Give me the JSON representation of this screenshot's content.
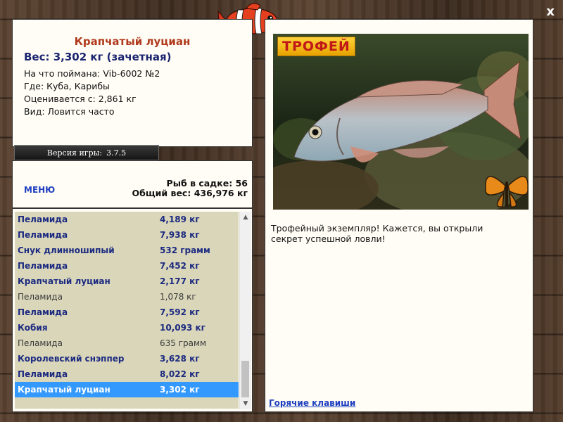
{
  "window": {
    "close_label": "x"
  },
  "info": {
    "title": "Крапчатый луциан",
    "weight_line": "Вес: 3,302 кг (зачетная)",
    "lines": [
      "На что поймана: Vib-6002 №2",
      "Где: Куба, Карибы",
      "Оценивается с: 2,861 кг",
      "Вид: Ловится часто"
    ]
  },
  "version": {
    "label": "Версия игры:",
    "value": "3.7.5"
  },
  "menu": {
    "label": "МЕНЮ"
  },
  "stats": {
    "fish_in_keepnet": "Рыб в садке: 56",
    "total_weight": "Общий вес: 436,976 кг"
  },
  "catch_list": [
    {
      "name": "Пеламида",
      "weight": "4,189 кг",
      "trophy": true,
      "selected": false
    },
    {
      "name": "Пеламида",
      "weight": "7,938 кг",
      "trophy": true,
      "selected": false
    },
    {
      "name": "Снук длинношипый",
      "weight": "532 грамм",
      "trophy": true,
      "selected": false
    },
    {
      "name": "Пеламида",
      "weight": "7,452 кг",
      "trophy": true,
      "selected": false
    },
    {
      "name": "Крапчатый луциан",
      "weight": "2,177 кг",
      "trophy": true,
      "selected": false
    },
    {
      "name": "Пеламида",
      "weight": "1,078 кг",
      "trophy": false,
      "selected": false
    },
    {
      "name": "Пеламида",
      "weight": "7,592 кг",
      "trophy": true,
      "selected": false
    },
    {
      "name": "Кобия",
      "weight": "10,093 кг",
      "trophy": true,
      "selected": false
    },
    {
      "name": "Пеламида",
      "weight": "635 грамм",
      "trophy": false,
      "selected": false
    },
    {
      "name": "Королевский снэппер",
      "weight": "3,628 кг",
      "trophy": true,
      "selected": false
    },
    {
      "name": "Пеламида",
      "weight": "8,022 кг",
      "trophy": true,
      "selected": false
    },
    {
      "name": "Крапчатый луциан",
      "weight": "3,302 кг",
      "trophy": true,
      "selected": true
    }
  ],
  "trophy": {
    "badge": "ТРОФЕЙ",
    "text": "Трофейный экземпляр! Кажется, вы открыли секрет успешной ловли!"
  },
  "hotkeys": {
    "label": "Горячие клавиши"
  },
  "colors": {
    "title_red": "#b03a1d",
    "bold_blue": "#1c2a80",
    "link_blue": "#1f3fc0",
    "selection": "#3399ff",
    "list_bg": "#d9d6ba",
    "panel_bg": "#fffdf5"
  }
}
